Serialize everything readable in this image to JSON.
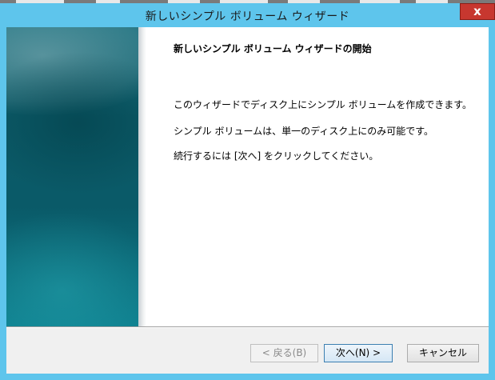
{
  "window": {
    "title": "新しいシンプル ボリューム ウィザード",
    "close_label": "x"
  },
  "wizard": {
    "heading": "新しいシンプル ボリューム ウィザードの開始",
    "lines": [
      "このウィザードでディスク上にシンプル ボリュームを作成できます。",
      "シンプル ボリュームは、単一のディスク上にのみ可能です。",
      "続行するには [次へ] をクリックしてください。"
    ]
  },
  "buttons": {
    "back": "< 戻る(B)",
    "next": "次へ(N) >",
    "cancel": "キャンセル"
  },
  "colors": {
    "title_bar": "#5ec5ec",
    "close_button": "#c7372f",
    "banner": "#0c5a67"
  }
}
